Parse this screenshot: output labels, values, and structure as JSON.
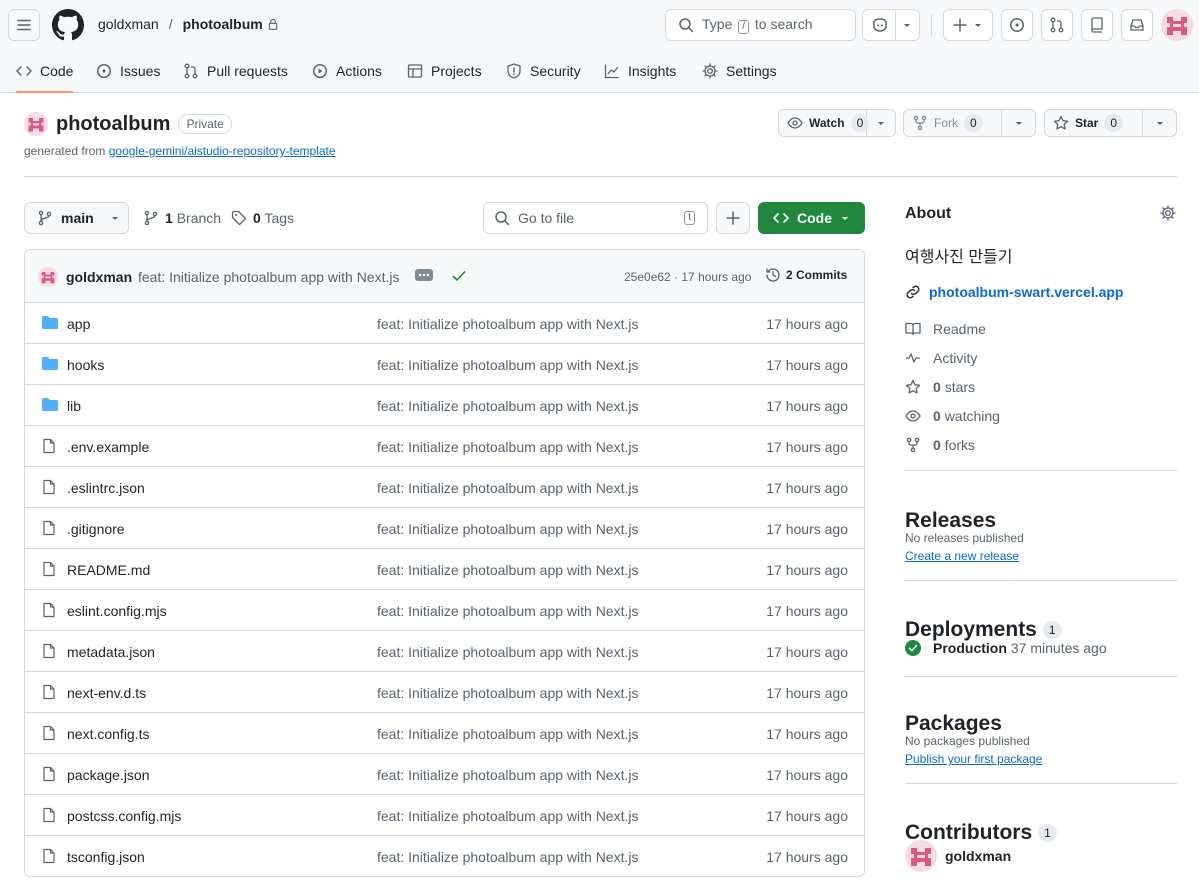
{
  "header": {
    "owner": "goldxman",
    "separator": "/",
    "repo": "photoalbum",
    "search_prefix": "Type",
    "search_key": "/",
    "search_suffix": "to search"
  },
  "nav": {
    "tabs": [
      {
        "label": "Code",
        "icon": "code-icon",
        "active": true
      },
      {
        "label": "Issues",
        "icon": "issue-icon"
      },
      {
        "label": "Pull requests",
        "icon": "pull-request-icon"
      },
      {
        "label": "Actions",
        "icon": "play-icon"
      },
      {
        "label": "Projects",
        "icon": "table-icon"
      },
      {
        "label": "Security",
        "icon": "shield-icon"
      },
      {
        "label": "Insights",
        "icon": "graph-icon"
      },
      {
        "label": "Settings",
        "icon": "gear-icon"
      }
    ]
  },
  "repo": {
    "name": "photoalbum",
    "visibility": "Private",
    "generated_prefix": "generated from",
    "template_link": "google-gemini/aistudio-repository-template",
    "watch": {
      "label": "Watch",
      "count": "0"
    },
    "fork": {
      "label": "Fork",
      "count": "0"
    },
    "star": {
      "label": "Star",
      "count": "0"
    }
  },
  "toolbar": {
    "branch": "main",
    "branches_count": "1",
    "branches_label": "Branch",
    "tags_count": "0",
    "tags_label": "Tags",
    "gofile_placeholder": "Go to file",
    "gofile_key": "t",
    "code_label": "Code"
  },
  "commit": {
    "author": "goldxman",
    "message": "feat: Initialize photoalbum app with Next.js",
    "sha_time": "25e0e62 · 17 hours ago",
    "commits_label": "2 Commits"
  },
  "files": [
    {
      "name": "app",
      "type": "dir",
      "message": "feat: Initialize photoalbum app with Next.js",
      "time": "17 hours ago"
    },
    {
      "name": "hooks",
      "type": "dir",
      "message": "feat: Initialize photoalbum app with Next.js",
      "time": "17 hours ago"
    },
    {
      "name": "lib",
      "type": "dir",
      "message": "feat: Initialize photoalbum app with Next.js",
      "time": "17 hours ago"
    },
    {
      "name": ".env.example",
      "type": "file",
      "message": "feat: Initialize photoalbum app with Next.js",
      "time": "17 hours ago"
    },
    {
      "name": ".eslintrc.json",
      "type": "file",
      "message": "feat: Initialize photoalbum app with Next.js",
      "time": "17 hours ago"
    },
    {
      "name": ".gitignore",
      "type": "file",
      "message": "feat: Initialize photoalbum app with Next.js",
      "time": "17 hours ago"
    },
    {
      "name": "README.md",
      "type": "file",
      "message": "feat: Initialize photoalbum app with Next.js",
      "time": "17 hours ago"
    },
    {
      "name": "eslint.config.mjs",
      "type": "file",
      "message": "feat: Initialize photoalbum app with Next.js",
      "time": "17 hours ago"
    },
    {
      "name": "metadata.json",
      "type": "file",
      "message": "feat: Initialize photoalbum app with Next.js",
      "time": "17 hours ago"
    },
    {
      "name": "next-env.d.ts",
      "type": "file",
      "message": "feat: Initialize photoalbum app with Next.js",
      "time": "17 hours ago"
    },
    {
      "name": "next.config.ts",
      "type": "file",
      "message": "feat: Initialize photoalbum app with Next.js",
      "time": "17 hours ago"
    },
    {
      "name": "package.json",
      "type": "file",
      "message": "feat: Initialize photoalbum app with Next.js",
      "time": "17 hours ago"
    },
    {
      "name": "postcss.config.mjs",
      "type": "file",
      "message": "feat: Initialize photoalbum app with Next.js",
      "time": "17 hours ago"
    },
    {
      "name": "tsconfig.json",
      "type": "file",
      "message": "feat: Initialize photoalbum app with Next.js",
      "time": "17 hours ago"
    }
  ],
  "sidebar": {
    "about_title": "About",
    "description": "여행사진 만들기",
    "website": "photoalbum-swart.vercel.app",
    "readme": "Readme",
    "activity": "Activity",
    "stars_count": "0",
    "stars_label": "stars",
    "watching_count": "0",
    "watching_label": "watching",
    "forks_count": "0",
    "forks_label": "forks",
    "releases_title": "Releases",
    "releases_none": "No releases published",
    "releases_link": "Create a new release",
    "deployments_title": "Deployments",
    "deployments_count": "1",
    "deployment_name": "Production",
    "deployment_time": "37 minutes ago",
    "packages_title": "Packages",
    "packages_none": "No packages published",
    "packages_link": "Publish your first package",
    "contributors_title": "Contributors",
    "contributors_count": "1",
    "contributor": "goldxman"
  },
  "colors": {
    "accent_green": "#1f883d",
    "link_blue": "#0969da",
    "folder_blue": "#54aeff",
    "avatar_pink": "#d9597f",
    "tab_underline": "#fd8c73"
  }
}
